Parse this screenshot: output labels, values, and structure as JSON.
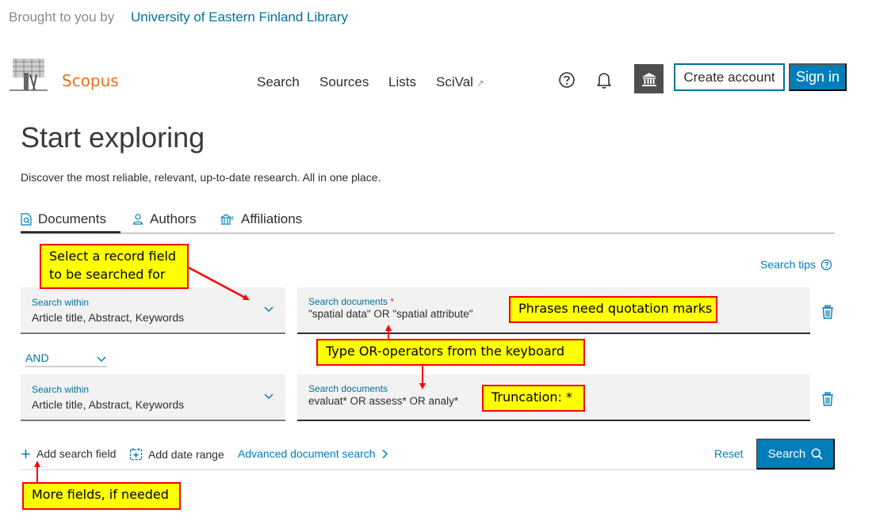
{
  "banner": {
    "brought_by": "Brought to you by",
    "library": "University of Eastern Finland Library"
  },
  "header": {
    "logo_text": "Scopus",
    "nav": [
      {
        "label": "Search"
      },
      {
        "label": "Sources"
      },
      {
        "label": "Lists"
      },
      {
        "label": "SciVal",
        "external_icon": "↗"
      }
    ],
    "icons": [
      "help-icon",
      "bell-icon",
      "institution-icon"
    ],
    "create_account": "Create account",
    "sign_in": "Sign in"
  },
  "page": {
    "title": "Start exploring",
    "subtitle": "Discover the most reliable, relevant, up-to-date research. All in one place."
  },
  "tabs": [
    {
      "label": "Documents",
      "icon": "document-search-icon",
      "active": true
    },
    {
      "label": "Authors",
      "icon": "person-icon",
      "active": false
    },
    {
      "label": "Affiliations",
      "icon": "building-icon",
      "active": false
    }
  ],
  "search_tips": "Search tips",
  "rows": [
    {
      "within_label": "Search within",
      "within_value": "Article title, Abstract, Keywords",
      "doc_label": "Search documents",
      "required": "*",
      "doc_value": "\"spatial data\" OR \"spatial attribute\""
    },
    {
      "within_label": "Search within",
      "within_value": "Article title, Abstract, Keywords",
      "doc_label": "Search documents",
      "doc_value": "evaluat* OR assess* OR analy*"
    }
  ],
  "operator": "AND",
  "actions": {
    "add_field": "Add search field",
    "add_date": "Add date range",
    "advanced": "Advanced document search",
    "reset": "Reset",
    "search": "Search"
  },
  "callouts": {
    "select_field": "Select a record field to be searched for",
    "phrases": "Phrases need quotation marks",
    "or_operators": "Type OR-operators from the keyboard",
    "truncation": "Truncation: *",
    "more_fields": "More fields, if needed"
  },
  "colors": {
    "brand_orange": "#e9711c",
    "link_blue": "#007398",
    "primary_blue": "#007eb9",
    "callout_fill": "#ffff00",
    "callout_border": "#ff0000"
  }
}
